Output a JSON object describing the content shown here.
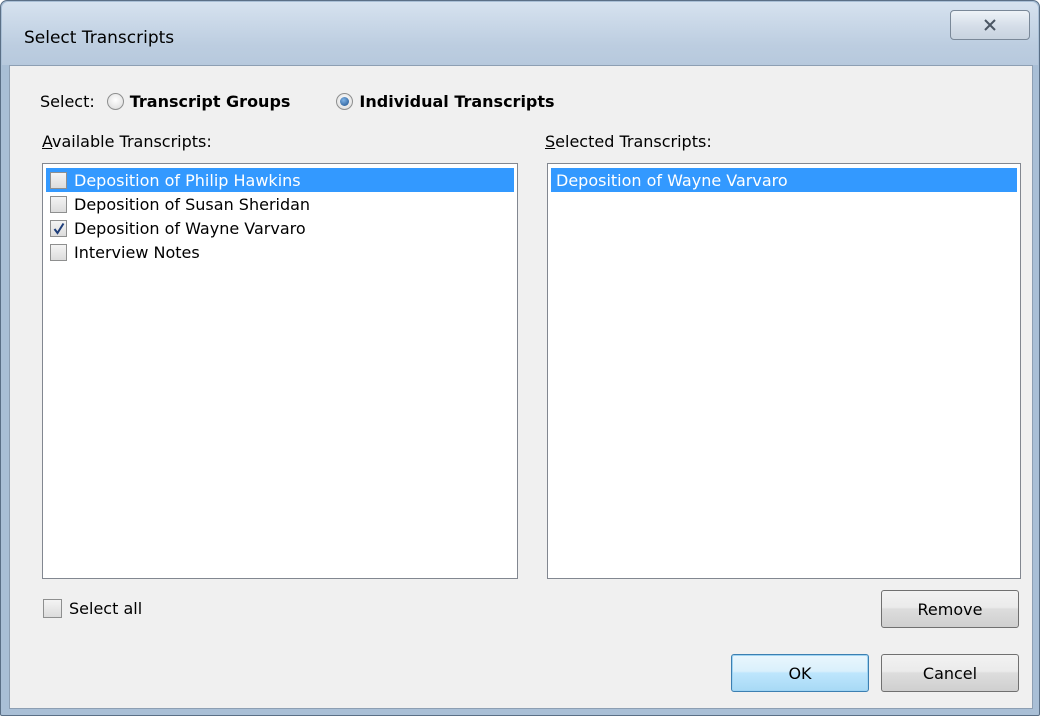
{
  "window": {
    "title": "Select Transcripts"
  },
  "select_mode": {
    "label": "Select:",
    "options": [
      {
        "label": "Transcript Groups",
        "selected": false
      },
      {
        "label": "Individual Transcripts",
        "selected": true
      }
    ]
  },
  "available": {
    "label_first": "A",
    "label_rest": "vailable Transcripts:",
    "items": [
      {
        "label": "Deposition of Philip Hawkins",
        "checked": false,
        "highlighted": true
      },
      {
        "label": "Deposition of Susan Sheridan",
        "checked": false,
        "highlighted": false
      },
      {
        "label": "Deposition of Wayne Varvaro",
        "checked": true,
        "highlighted": false
      },
      {
        "label": "Interview Notes",
        "checked": false,
        "highlighted": false
      }
    ]
  },
  "selected": {
    "label_first": "S",
    "label_rest": "elected Transcripts:",
    "items": [
      {
        "label": "Deposition of Wayne Varvaro",
        "highlighted": true
      }
    ]
  },
  "select_all": {
    "label": "Select all",
    "checked": false
  },
  "buttons": {
    "remove": "Remove",
    "ok": "OK",
    "cancel": "Cancel"
  },
  "colors": {
    "highlight": "#3399ff",
    "client_bg": "#f0f0f0",
    "frame": "#a9bfd6"
  },
  "icons": {
    "close": "close-icon",
    "check": "check-mark-icon"
  }
}
